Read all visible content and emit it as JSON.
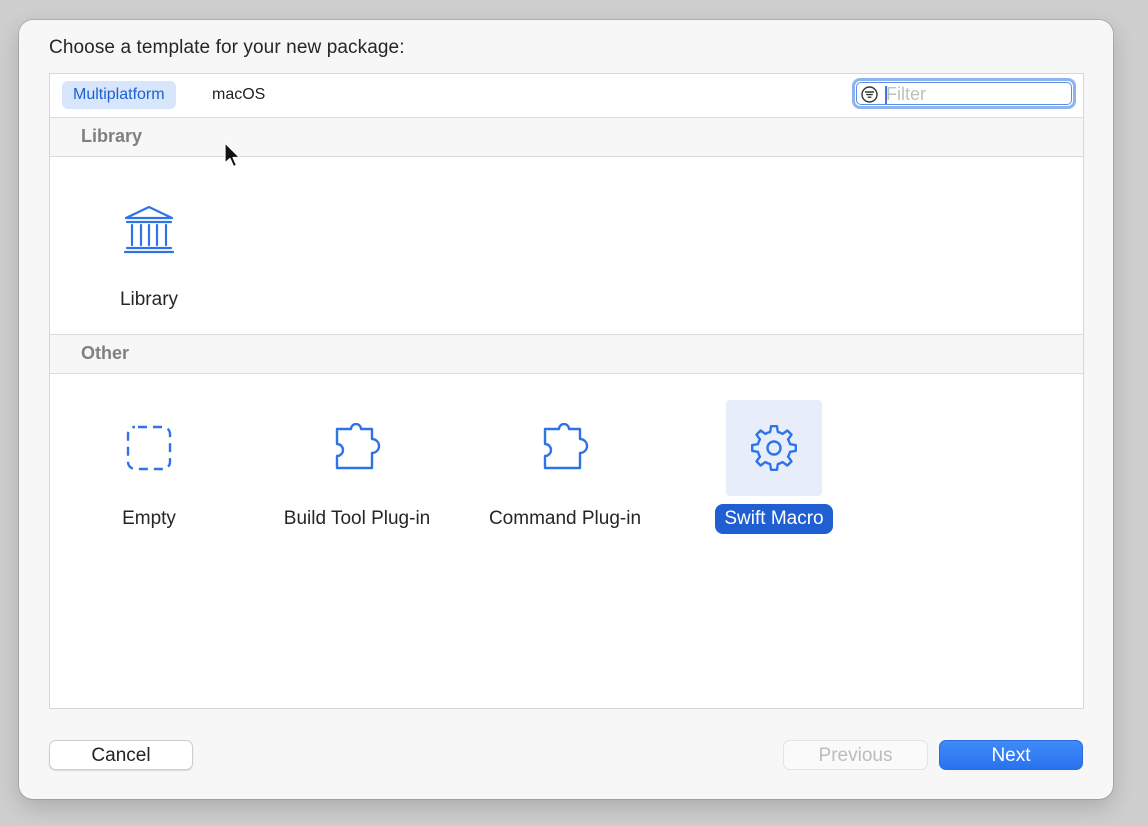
{
  "dialog": {
    "heading": "Choose a template for your new package:"
  },
  "tabs": [
    {
      "label": "Multiplatform",
      "active": true
    },
    {
      "label": "macOS",
      "active": false
    }
  ],
  "filter": {
    "placeholder": "Filter",
    "value": ""
  },
  "sections": [
    {
      "title": "Library",
      "templates": [
        {
          "label": "Library",
          "icon": "library-icon",
          "selected": false
        }
      ]
    },
    {
      "title": "Other",
      "templates": [
        {
          "label": "Empty",
          "icon": "empty-dashed-square-icon",
          "selected": false
        },
        {
          "label": "Build Tool Plug-in",
          "icon": "puzzle-piece-icon",
          "selected": false
        },
        {
          "label": "Command Plug-in",
          "icon": "puzzle-piece-icon",
          "selected": false
        },
        {
          "label": "Swift Macro",
          "icon": "gear-icon",
          "selected": true
        }
      ]
    }
  ],
  "buttons": {
    "cancel": "Cancel",
    "previous": "Previous",
    "next": "Next"
  },
  "colors": {
    "accent": "#1f5fd1",
    "icon": "#2f74e6",
    "selected_tile_bg": "#e8eef9",
    "active_tab_bg": "#d7e6fb"
  }
}
